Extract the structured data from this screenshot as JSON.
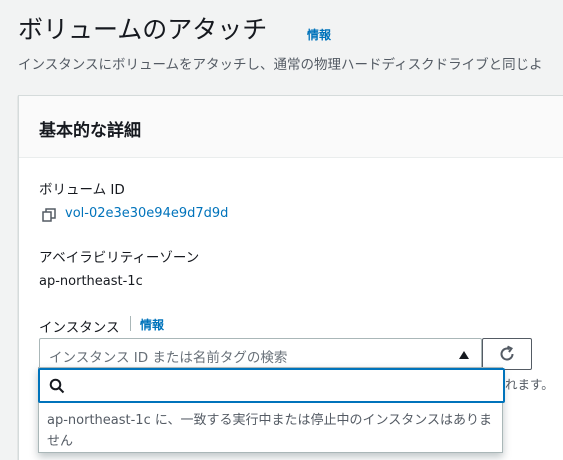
{
  "page": {
    "title": "ボリュームのアタッチ",
    "info": "情報",
    "description": "インスタンスにボリュームをアタッチし、通常の物理ハードディスクドライブと同じよ"
  },
  "panel": {
    "title": "基本的な詳細",
    "volume_id_label": "ボリューム ID",
    "volume_id": "vol-02e3e30e94e9d7d9d",
    "az_label": "アベイラビリティーゾーン",
    "az_value": "ap-northeast-1c",
    "instance_label": "インスタンス",
    "instance_info": "情報",
    "instance_placeholder": "インスタンス ID または名前タグの検索",
    "behind_text": "れます。"
  },
  "dropdown": {
    "search_value": "",
    "empty_message": "ap-northeast-1c に、一致する実行中または停止中のインスタンスはありません"
  },
  "colors": {
    "link": "#0073bb",
    "focus": "#0073bb",
    "text": "#16191f",
    "secondary": "#545b64"
  }
}
